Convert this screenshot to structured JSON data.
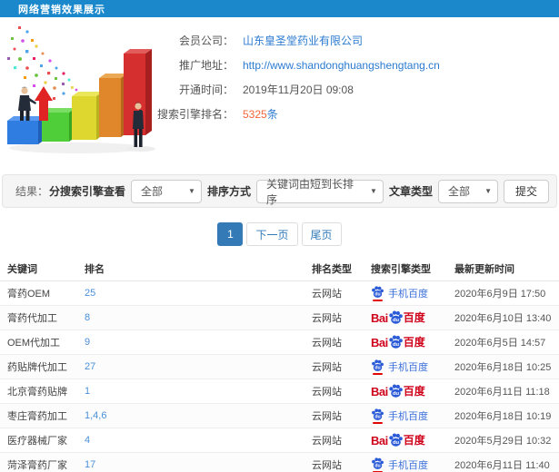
{
  "header": {
    "title": "网络营销效果展示"
  },
  "info": {
    "rows": [
      {
        "label": "会员公司：",
        "value": "山东皇圣堂药业有限公司"
      },
      {
        "label": "推广地址：",
        "value": "http://www.shandonghuangshengtang.cn"
      },
      {
        "label": "开通时间：",
        "value": "2019年11月20日 09:08"
      },
      {
        "label": "搜索引擎排名：",
        "value": "5325",
        "suffix": "条"
      }
    ]
  },
  "filters": {
    "result_label": "结果：",
    "engine_label": "分搜索引擎查看",
    "engine_value": "全部",
    "sort_label": "排序方式",
    "sort_value": "关键词由短到长排序",
    "article_label": "文章类型",
    "article_value": "全部",
    "submit_label": "提交"
  },
  "pagination": {
    "current": "1",
    "next": "下一页",
    "last": "尾页"
  },
  "table": {
    "headers": [
      "关键词",
      "排名",
      "排名类型",
      "搜索引擎类型",
      "最新更新时间"
    ],
    "rows": [
      {
        "keyword": "膏药OEM",
        "rank": "25",
        "rank_type": "云网站",
        "engine": "手机百度",
        "updated": "2020年6月9日 17:50"
      },
      {
        "keyword": "膏药代加工",
        "rank": "8",
        "rank_type": "云网站",
        "engine": "百度",
        "updated": "2020年6月10日 13:40"
      },
      {
        "keyword": "OEM代加工",
        "rank": "9",
        "rank_type": "云网站",
        "engine": "百度",
        "updated": "2020年6月5日 14:57"
      },
      {
        "keyword": "药贴牌代加工",
        "rank": "27",
        "rank_type": "云网站",
        "engine": "手机百度",
        "updated": "2020年6月18日 10:25"
      },
      {
        "keyword": "北京膏药贴牌",
        "rank": "1",
        "rank_type": "云网站",
        "engine": "百度",
        "updated": "2020年6月11日 11:18"
      },
      {
        "keyword": "枣庄膏药加工",
        "rank": "1,4,6",
        "rank_type": "云网站",
        "engine": "手机百度",
        "updated": "2020年6月18日 10:19"
      },
      {
        "keyword": "医疗器械厂家",
        "rank": "4",
        "rank_type": "云网站",
        "engine": "百度",
        "updated": "2020年5月29日 10:32"
      },
      {
        "keyword": "菏泽膏药厂家",
        "rank": "17",
        "rank_type": "云网站",
        "engine": "手机百度",
        "updated": "2020年6月11日 11:40"
      }
    ],
    "engine_names": {
      "mobile": "手机百度",
      "baidu": "百度"
    },
    "baidu_logo_text": {
      "bai": "Bai",
      "du": "du",
      "bd": "百度"
    }
  },
  "colors": {
    "header_bg": "#1a88cb",
    "link_blue": "#2b7bd0",
    "accent_blue": "#337ab7",
    "rank_blue": "#4a90d9",
    "highlight_orange": "#f0663a",
    "baidu_red": "#d0021b",
    "baidu_paw_blue": "#2b5bd7"
  }
}
